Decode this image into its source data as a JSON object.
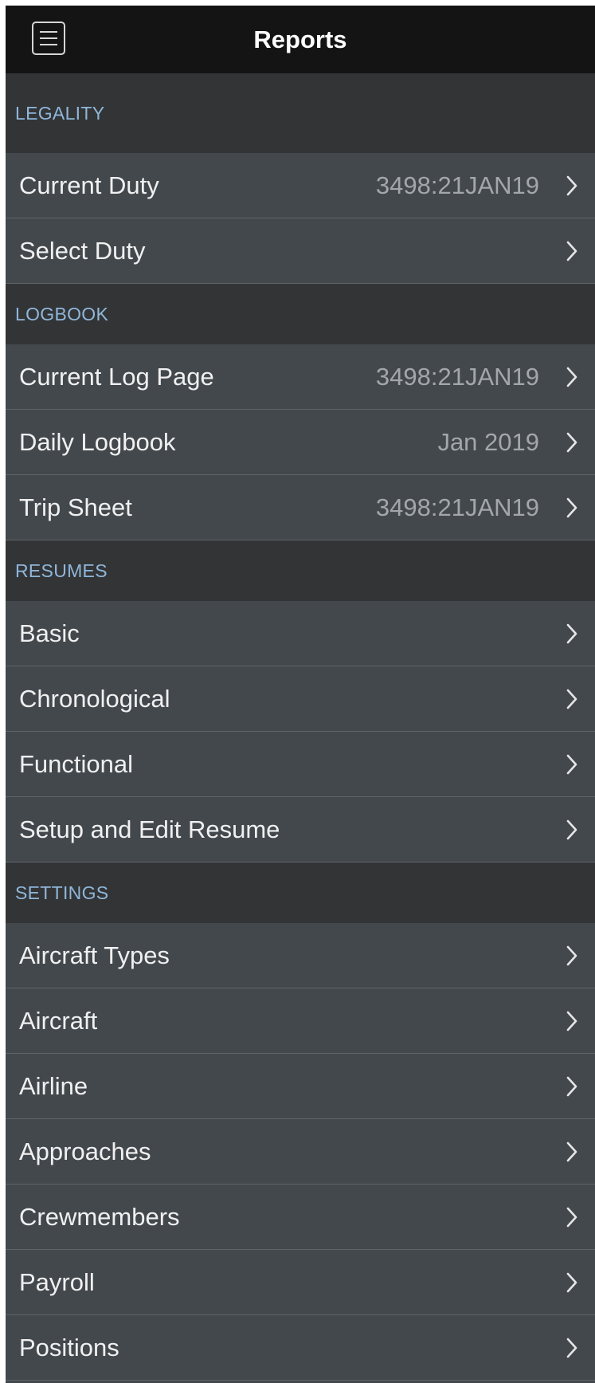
{
  "header": {
    "title": "Reports",
    "menu_icon": "hamburger-menu-icon"
  },
  "colors": {
    "header_bg": "#141414",
    "section_bg": "#333436",
    "section_text": "#8fb7da",
    "row_bg": "#43484d",
    "row_text": "#f0f0f0",
    "value_text": "#a3a7ab",
    "divider": "#5e646a"
  },
  "sections": [
    {
      "title": "LEGALITY",
      "items": [
        {
          "label": "Current Duty",
          "value": "3498:21JAN19"
        },
        {
          "label": "Select Duty",
          "value": ""
        }
      ]
    },
    {
      "title": "LOGBOOK",
      "items": [
        {
          "label": "Current Log Page",
          "value": "3498:21JAN19"
        },
        {
          "label": "Daily Logbook",
          "value": "Jan 2019"
        },
        {
          "label": "Trip Sheet",
          "value": "3498:21JAN19"
        }
      ]
    },
    {
      "title": "RESUMES",
      "items": [
        {
          "label": "Basic",
          "value": ""
        },
        {
          "label": "Chronological",
          "value": ""
        },
        {
          "label": "Functional",
          "value": ""
        },
        {
          "label": "Setup and Edit Resume",
          "value": ""
        }
      ]
    },
    {
      "title": "SETTINGS",
      "items": [
        {
          "label": "Aircraft Types",
          "value": ""
        },
        {
          "label": "Aircraft",
          "value": ""
        },
        {
          "label": "Airline",
          "value": ""
        },
        {
          "label": "Approaches",
          "value": ""
        },
        {
          "label": "Crewmembers",
          "value": ""
        },
        {
          "label": "Payroll",
          "value": ""
        },
        {
          "label": "Positions",
          "value": ""
        }
      ]
    }
  ]
}
